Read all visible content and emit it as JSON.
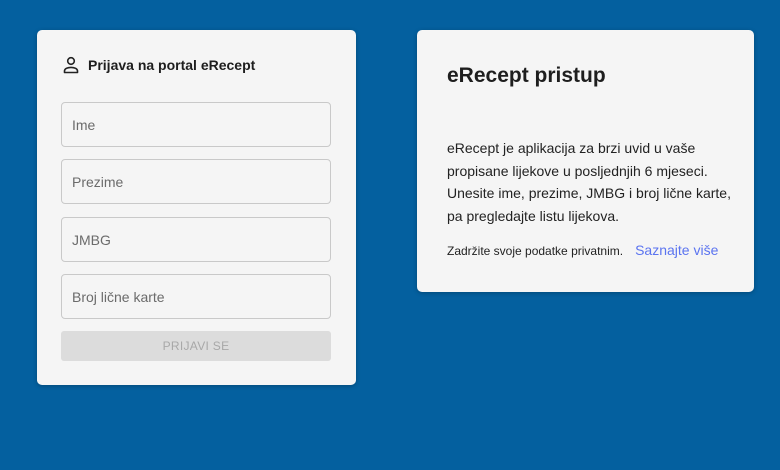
{
  "login": {
    "title": "Prijava na portal eRecept",
    "icon": "person-icon",
    "fields": {
      "first_name_placeholder": "Ime",
      "last_name_placeholder": "Prezime",
      "jmbg_placeholder": "JMBG",
      "id_card_placeholder": "Broj lične karte"
    },
    "submit_label": "PRIJAVI SE"
  },
  "info": {
    "title": "eRecept pristup",
    "description": "eRecept je aplikacija za brzi uvid u vaše propisane lijekove u posljednjih 6 mjeseci. Unesite ime, prezime, JMBG i broj lične karte, pa pregledajte listu lijekova.",
    "privacy_text": "Zadržite svoje podatke privatnim.",
    "learn_more_label": "Saznajte više"
  },
  "colors": {
    "background": "#04609f",
    "card": "#f5f5f5",
    "link": "#5b74f0",
    "button_disabled": "#dcdcdc"
  }
}
